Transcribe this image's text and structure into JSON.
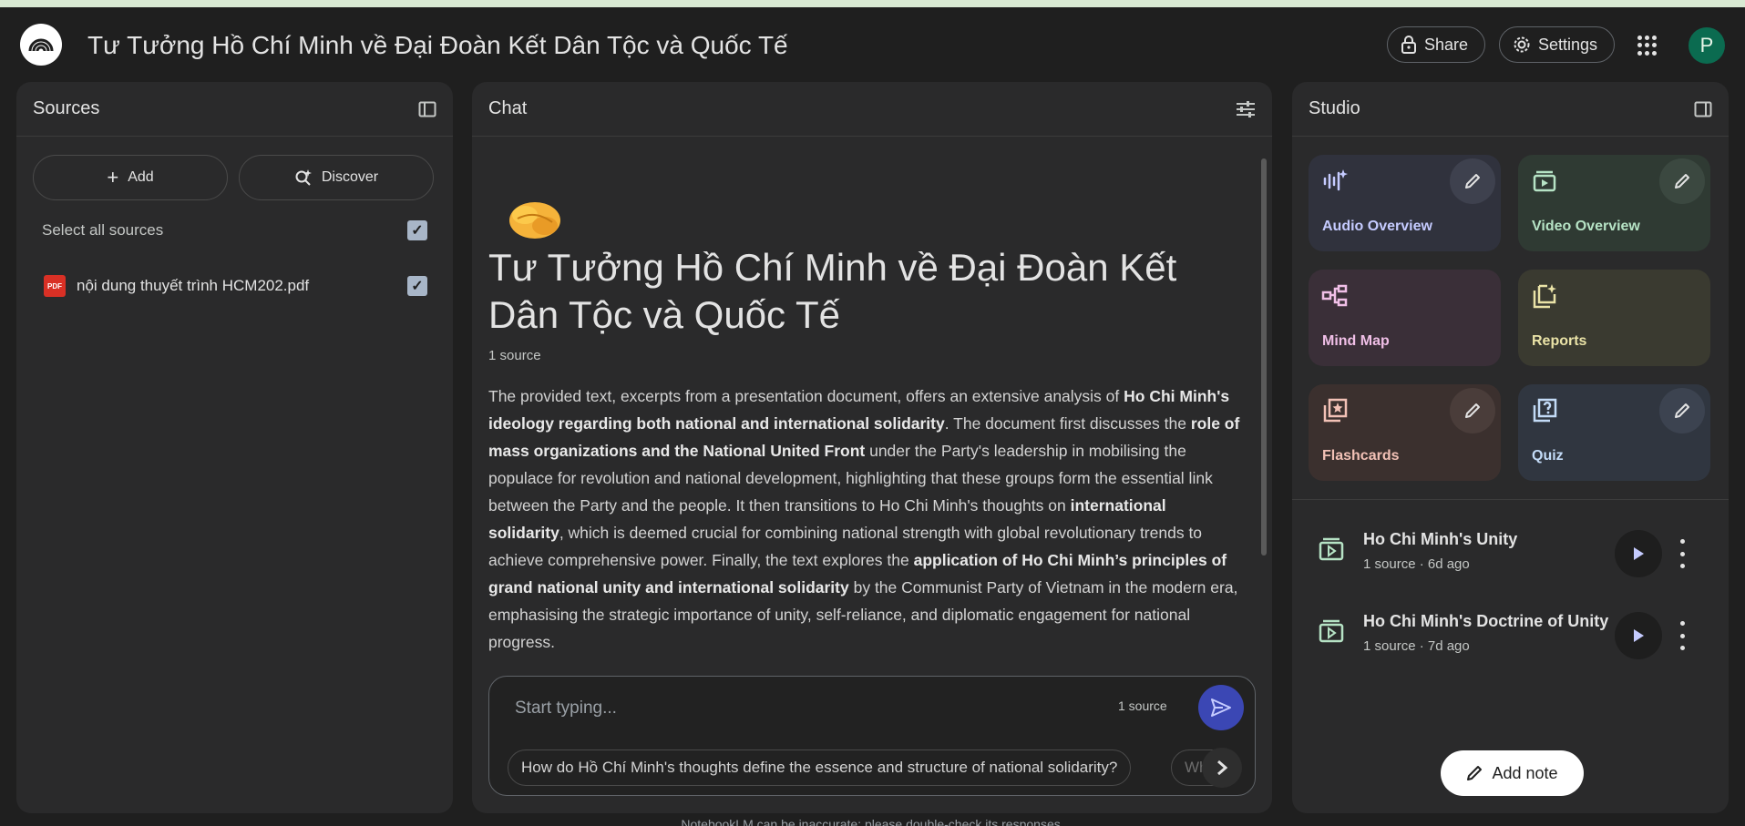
{
  "header": {
    "title": "Tư Tưởng Hồ Chí Minh về Đại Đoàn Kết Dân Tộc và Quốc Tế",
    "share_label": "Share",
    "settings_label": "Settings",
    "avatar_initial": "P",
    "logo_icon": "notebook-logo-icon"
  },
  "sources": {
    "title": "Sources",
    "add_label": "Add",
    "discover_label": "Discover",
    "select_all_label": "Select all sources",
    "items": [
      {
        "name": "nội dung thuyết trình HCM202.pdf",
        "type": "PDF",
        "checked": true
      }
    ]
  },
  "chat": {
    "title": "Chat",
    "emoji_icon": "handshake-icon",
    "notebook_title": "Tư Tưởng Hồ Chí Minh về Đại Đoàn Kết Dân Tộc và Quốc Tế",
    "source_count": "1 source",
    "summary": [
      {
        "text": "The provided text, excerpts from a presentation document, offers an extensive analysis of ",
        "bold": false
      },
      {
        "text": "Ho Chi Minh's ideology regarding both national and international solidarity",
        "bold": true
      },
      {
        "text": ". The document first discusses the ",
        "bold": false
      },
      {
        "text": "role of mass organizations and the National United Front",
        "bold": true
      },
      {
        "text": " under the Party's leadership in mobilising the populace for revolution and national development, highlighting that these groups form the essential link between the Party and the people. It then transitions to Ho Chi Minh's thoughts on ",
        "bold": false
      },
      {
        "text": "international solidarity",
        "bold": true
      },
      {
        "text": ", which is deemed crucial for combining national strength with global revolutionary trends to achieve comprehensive power. Finally, the text explores the ",
        "bold": false
      },
      {
        "text": "application of Ho Chi Minh’s principles of grand national unity and international solidarity",
        "bold": true
      },
      {
        "text": " by the Communist Party of Vietnam in the modern era, emphasising the strategic importance of unity, self-reliance, and diplomatic engagement for national progress.",
        "bold": false
      }
    ],
    "input_placeholder": "Start typing...",
    "input_source_count": "1 source",
    "suggestion": "How do Hồ Chí Minh's thoughts define the essence and structure of national solidarity?",
    "suggestion_next_partial": "Wh"
  },
  "studio": {
    "title": "Studio",
    "cards": [
      {
        "label": "Audio Overview",
        "icon": "audio-waveform-icon",
        "bg": "#30323d",
        "color": "#c5cbff"
      },
      {
        "label": "Video Overview",
        "icon": "video-icon",
        "bg": "#2f3a33",
        "color": "#b6e3c5"
      },
      {
        "label": "Mind Map",
        "icon": "mind-map-icon",
        "bg": "#3a2f38",
        "color": "#f0bfe7"
      },
      {
        "label": "Reports",
        "icon": "reports-icon",
        "bg": "#3a3a30",
        "color": "#eae3a7"
      },
      {
        "label": "Flashcards",
        "icon": "flashcards-icon",
        "bg": "#3b302e",
        "color": "#f2c1b6"
      },
      {
        "label": "Quiz",
        "icon": "quiz-icon",
        "bg": "#303640",
        "color": "#c3dbf7"
      }
    ],
    "notes": [
      {
        "title": "Ho Chi Minh's Unity",
        "meta": "1 source · 6d ago"
      },
      {
        "title": "Ho Chi Minh's Doctrine of Unity",
        "meta": "1 source · 7d ago"
      }
    ],
    "add_note_label": "Add note"
  },
  "footer": {
    "text": "NotebookLM can be inaccurate; please double-check its responses."
  }
}
